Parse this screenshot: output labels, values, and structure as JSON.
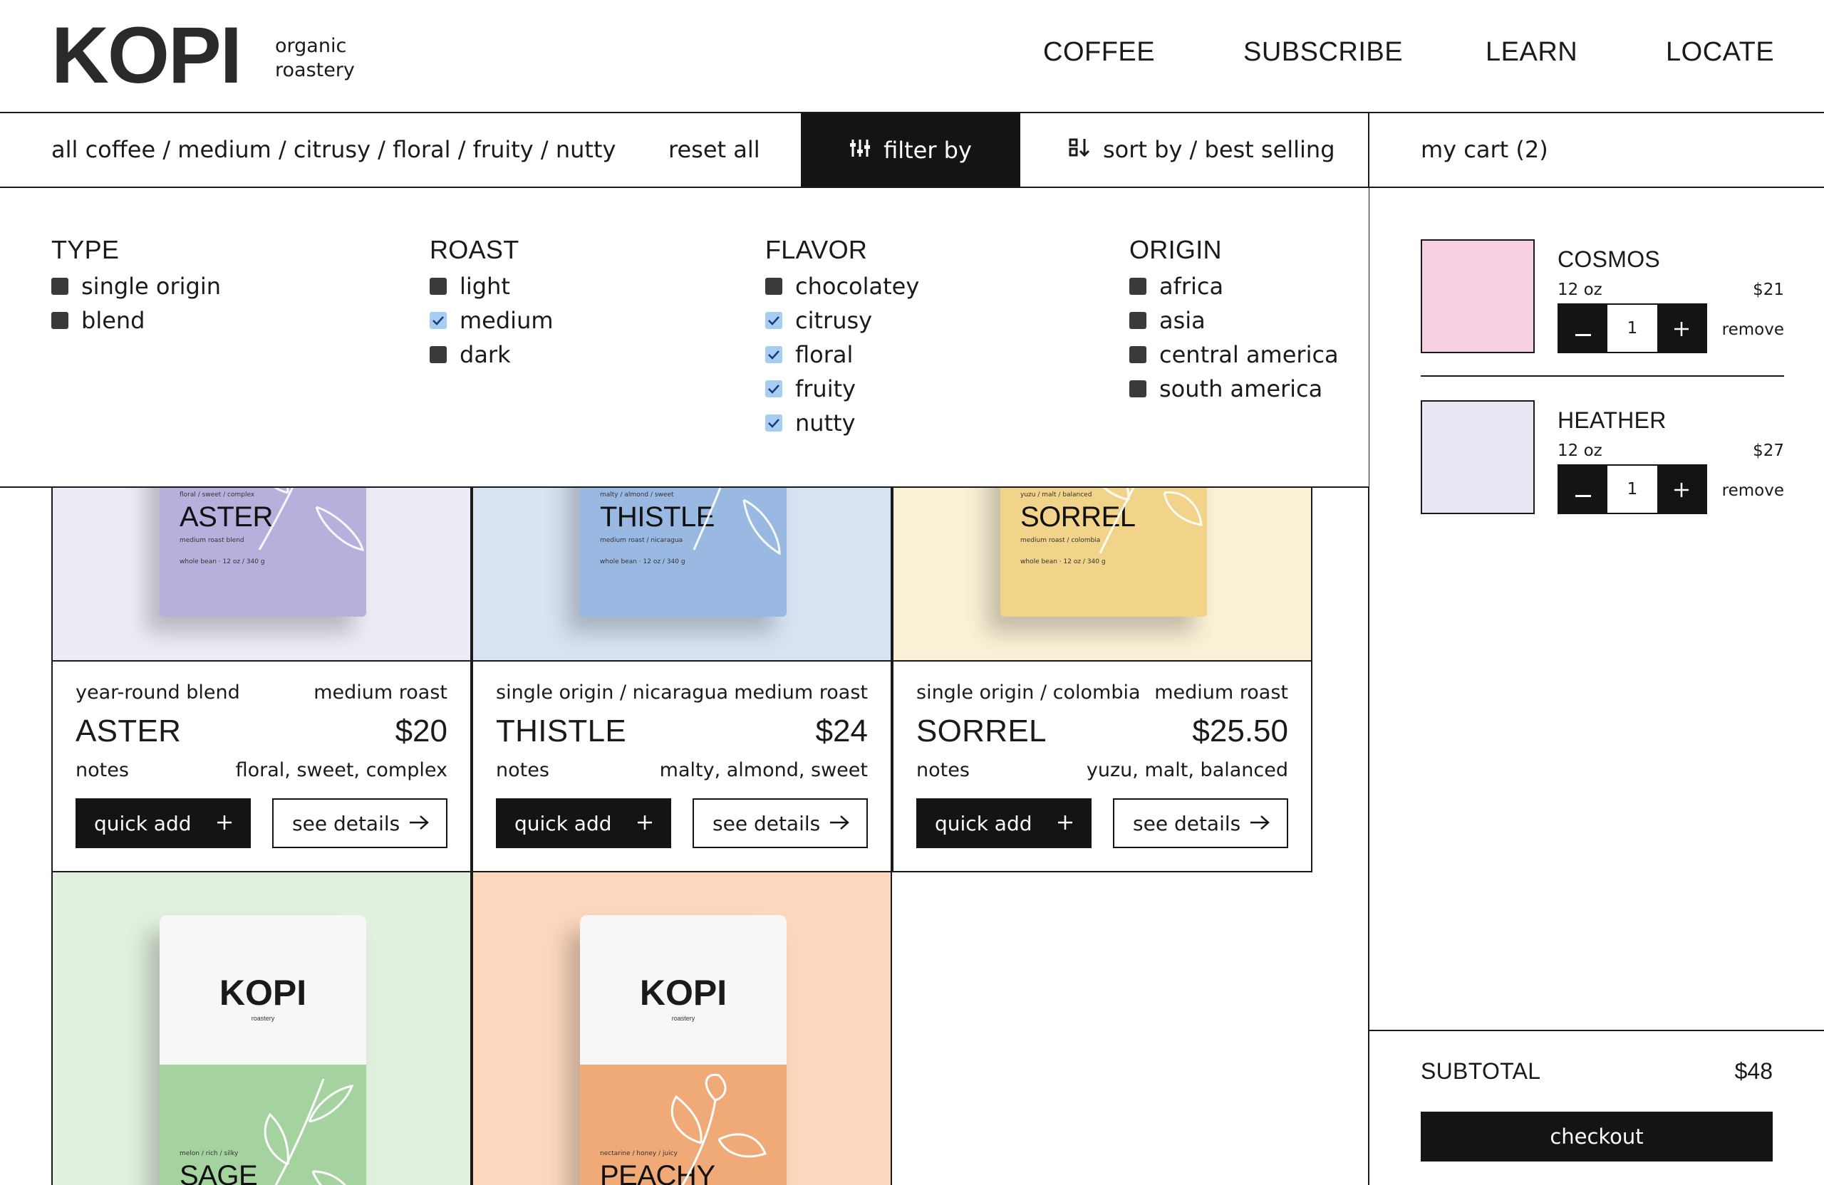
{
  "brand": {
    "name": "KOPI",
    "sub_line1": "organic",
    "sub_line2": "roastery"
  },
  "nav": [
    "COFFEE",
    "SUBSCRIBE",
    "LEARN",
    "LOCATE"
  ],
  "toolbar": {
    "breadcrumb": "all coffee / medium / citrusy / floral / fruity / nutty",
    "reset": "reset all",
    "filter": "filter by",
    "sort": "sort by / best selling",
    "cart": "my cart (2)"
  },
  "filters": [
    {
      "title": "TYPE",
      "options": [
        {
          "label": "single origin",
          "checked": false
        },
        {
          "label": "blend",
          "checked": false
        }
      ]
    },
    {
      "title": "ROAST",
      "options": [
        {
          "label": "light",
          "checked": false
        },
        {
          "label": "medium",
          "checked": true
        },
        {
          "label": "dark",
          "checked": false
        }
      ]
    },
    {
      "title": "FLAVOR",
      "options": [
        {
          "label": "chocolatey",
          "checked": false
        },
        {
          "label": "citrusy",
          "checked": true
        },
        {
          "label": "floral",
          "checked": true
        },
        {
          "label": "fruity",
          "checked": true
        },
        {
          "label": "nutty",
          "checked": true
        }
      ]
    },
    {
      "title": "ORIGIN",
      "options": [
        {
          "label": "africa",
          "checked": false
        },
        {
          "label": "asia",
          "checked": false
        },
        {
          "label": "central america",
          "checked": false
        },
        {
          "label": "south america",
          "checked": false
        }
      ]
    }
  ],
  "products": [
    {
      "name": "ASTER",
      "type": "year-round blend",
      "roast": "medium roast",
      "price": "$20",
      "notes_label": "notes",
      "notes": "floral, sweet, complex",
      "bag_tagline": "floral / sweet / complex",
      "bag_sub": "medium roast blend",
      "bag_weight": "whole bean · 12 oz / 340 g",
      "bg": "#ecebf6",
      "bag_color": "#b7b0dc"
    },
    {
      "name": "THISTLE",
      "type": "single origin / nicaragua",
      "roast": "medium roast",
      "price": "$24",
      "notes_label": "notes",
      "notes": "malty, almond, sweet",
      "bag_tagline": "malty / almond / sweet",
      "bag_sub": "medium roast / nicaragua",
      "bag_weight": "whole bean · 12 oz / 340 g",
      "bg": "#d7e3f3",
      "bag_color": "#9ab9e2"
    },
    {
      "name": "SORREL",
      "type": "single origin / colombia",
      "roast": "medium roast",
      "price": "$25.50",
      "notes_label": "notes",
      "notes": "yuzu, malt, balanced",
      "bag_tagline": "yuzu / malt / balanced",
      "bag_sub": "medium roast / colombia",
      "bag_weight": "whole bean · 12 oz / 340 g",
      "bg": "#faf0d5",
      "bag_color": "#f1d489"
    },
    {
      "name": "SAGE",
      "bag_tagline": "melon / rich / silky",
      "bg": "#e2f1df",
      "bag_color": "#a5d3a0"
    },
    {
      "name": "PEACHY",
      "bag_tagline": "nectarine / honey / juicy",
      "bg": "#fbd7bd",
      "bag_color": "#f0aa78"
    }
  ],
  "product_buttons": {
    "quick_add": "quick add",
    "see_details": "see details"
  },
  "cart": {
    "items": [
      {
        "name": "COSMOS",
        "size": "12 oz",
        "price": "$21",
        "qty": "1",
        "remove": "remove",
        "swatch": "#f6d0e2"
      },
      {
        "name": "HEATHER",
        "size": "12 oz",
        "price": "$27",
        "qty": "1",
        "remove": "remove",
        "swatch": "#e9e7f4"
      }
    ],
    "subtotal_label": "SUBTOTAL",
    "subtotal": "$48",
    "checkout": "checkout"
  },
  "icons": {
    "filter": "sliders-icon",
    "sort": "sort-icon",
    "plus": "plus-icon",
    "arrow": "arrow-right-icon",
    "minus": "minus-icon"
  }
}
